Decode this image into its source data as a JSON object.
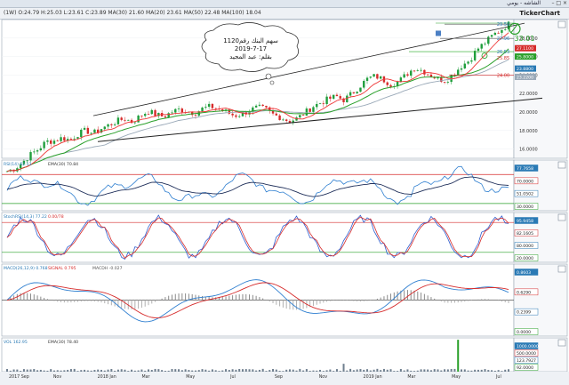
{
  "window": {
    "title": "الشاشه - يومي",
    "controls": "– □ ×"
  },
  "toolbar": {
    "info": "(1W)  O:24.79  H:25.03  L:23.61  C:23.89   MA(30) 21.60   MA(20) 23.61   MA(50) 22.48   MA(100) 18.04",
    "logo": "TickerChart"
  },
  "annotation": {
    "lines": [
      "سهم البنك رقم1120",
      "2019-7-17",
      "بقلم: عبد المجيد"
    ]
  },
  "chart_data": [
    {
      "type": "candlestick",
      "panel": "price",
      "price_labels": [
        "33.01",
        "29.50",
        "27.96",
        "26.53",
        "25.85",
        "24.00"
      ],
      "axis_ticks": [
        "28.0000",
        "26.0000",
        "24.0000",
        "22.0000",
        "20.0000",
        "18.0000",
        "16.0000"
      ],
      "axis_badges": [
        "25.8000",
        "27.1100",
        "23.8800",
        "23.2200"
      ],
      "ylim": [
        15,
        30
      ],
      "close_path": [
        13.6,
        13.9,
        14.6,
        15.4,
        16.0,
        16.8,
        16.9,
        17.2,
        17.0,
        17.6,
        18.0,
        17.7,
        18.2,
        18.6,
        19.0,
        19.3,
        18.9,
        19.6,
        20.1,
        19.7,
        19.5,
        20.0,
        20.3,
        20.1,
        19.9,
        20.4,
        20.6,
        20.3,
        20.0,
        19.6,
        19.8,
        20.2,
        20.5,
        20.3,
        19.7,
        19.4,
        19.0,
        19.3,
        19.9,
        20.6,
        21.0,
        21.4,
        21.7,
        21.3,
        22.0,
        22.8,
        23.6,
        23.9,
        23.5,
        23.0,
        23.3,
        24.1,
        24.8,
        24.5,
        24.0,
        23.6,
        23.4,
        24.2,
        25.0,
        25.6,
        26.8,
        27.5,
        28.3,
        28.9,
        29.5
      ],
      "trendlines": "up-channel, horizontal levels"
    },
    {
      "type": "line",
      "panel": "rsi",
      "legend": [
        "RSI(14)  62.13",
        "EMA(30)  70.84"
      ],
      "axis_badges": [
        "77.7658",
        "70.0000",
        "51.0502",
        "30.0000"
      ],
      "ylim": [
        20,
        90
      ]
    },
    {
      "type": "line",
      "panel": "stochastic",
      "legend": [
        "StochRSI(14,3) 77.22",
        "0.00/78"
      ],
      "axis_badges": [
        "95.9458",
        "82.1605",
        "80.0000",
        "20.0000"
      ],
      "ylim": [
        0,
        100
      ]
    },
    {
      "type": "line",
      "panel": "macd",
      "legend": [
        "MACD(26,12,9)  0.768",
        "SIGNAL  0.795",
        "MACDH  -0.027"
      ],
      "axis_badges": [
        "0.8603",
        "0.6290",
        "0.2399",
        "0.0000"
      ],
      "ylim": [
        -1.2,
        1.2
      ]
    },
    {
      "type": "bar",
      "panel": "volume",
      "legend": [
        "VOL  162.95",
        "EMA(30)  78.40"
      ],
      "axis_badges": [
        "1000.0000",
        "500.0000",
        "123.7927",
        "92.0000"
      ],
      "ylim": [
        0,
        1800
      ]
    }
  ],
  "x_axis_labels": [
    "2017 Sep",
    "Nov",
    "2018 Jan",
    "Mar",
    "May",
    "Jul",
    "Sep",
    "Nov",
    "2019 Jan",
    "Mar",
    "May",
    "Jul"
  ]
}
